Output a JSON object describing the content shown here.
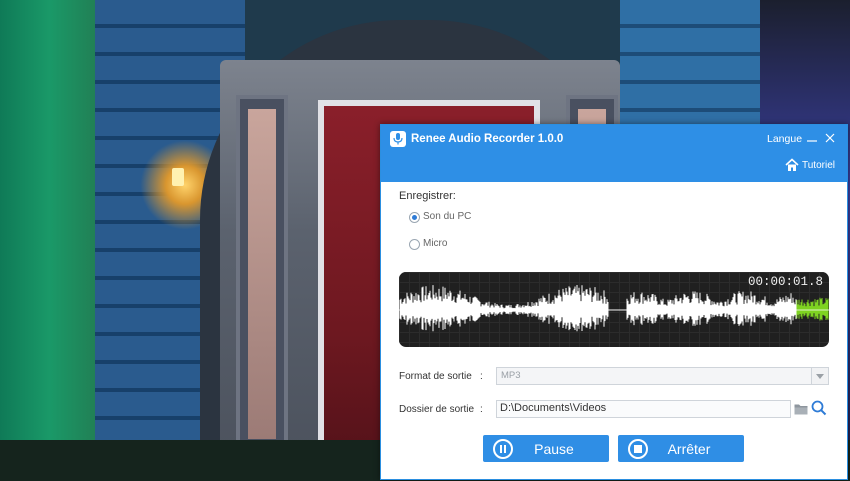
{
  "app": {
    "title": "Renee Audio Recorder 1.0.0",
    "language_label": "Langue",
    "tutorial_label": "Tutoriel"
  },
  "record": {
    "section_label": "Enregistrer:",
    "options": [
      {
        "label": "Son du PC",
        "selected": true
      },
      {
        "label": "Micro",
        "selected": false
      }
    ]
  },
  "waveform": {
    "elapsed": "00:00:01.8",
    "wave_color": "#ffffff",
    "live_color": "#7ed321"
  },
  "output": {
    "format_label": "Format de sortie",
    "format_value": "MP3",
    "folder_label": "Dossier de sortie",
    "folder_value": "D:\\Documents\\Videos",
    "separator": ":"
  },
  "buttons": {
    "pause": "Pause",
    "stop": "Arrêter"
  },
  "icons": {
    "app": "microphone-icon",
    "tutorial": "home-icon",
    "minimize": "minimize-icon",
    "close": "close-icon",
    "folder": "folder-icon",
    "search": "search-icon",
    "pause": "pause-icon",
    "stop": "stop-icon"
  },
  "colors": {
    "accent": "#2e8fe6"
  }
}
